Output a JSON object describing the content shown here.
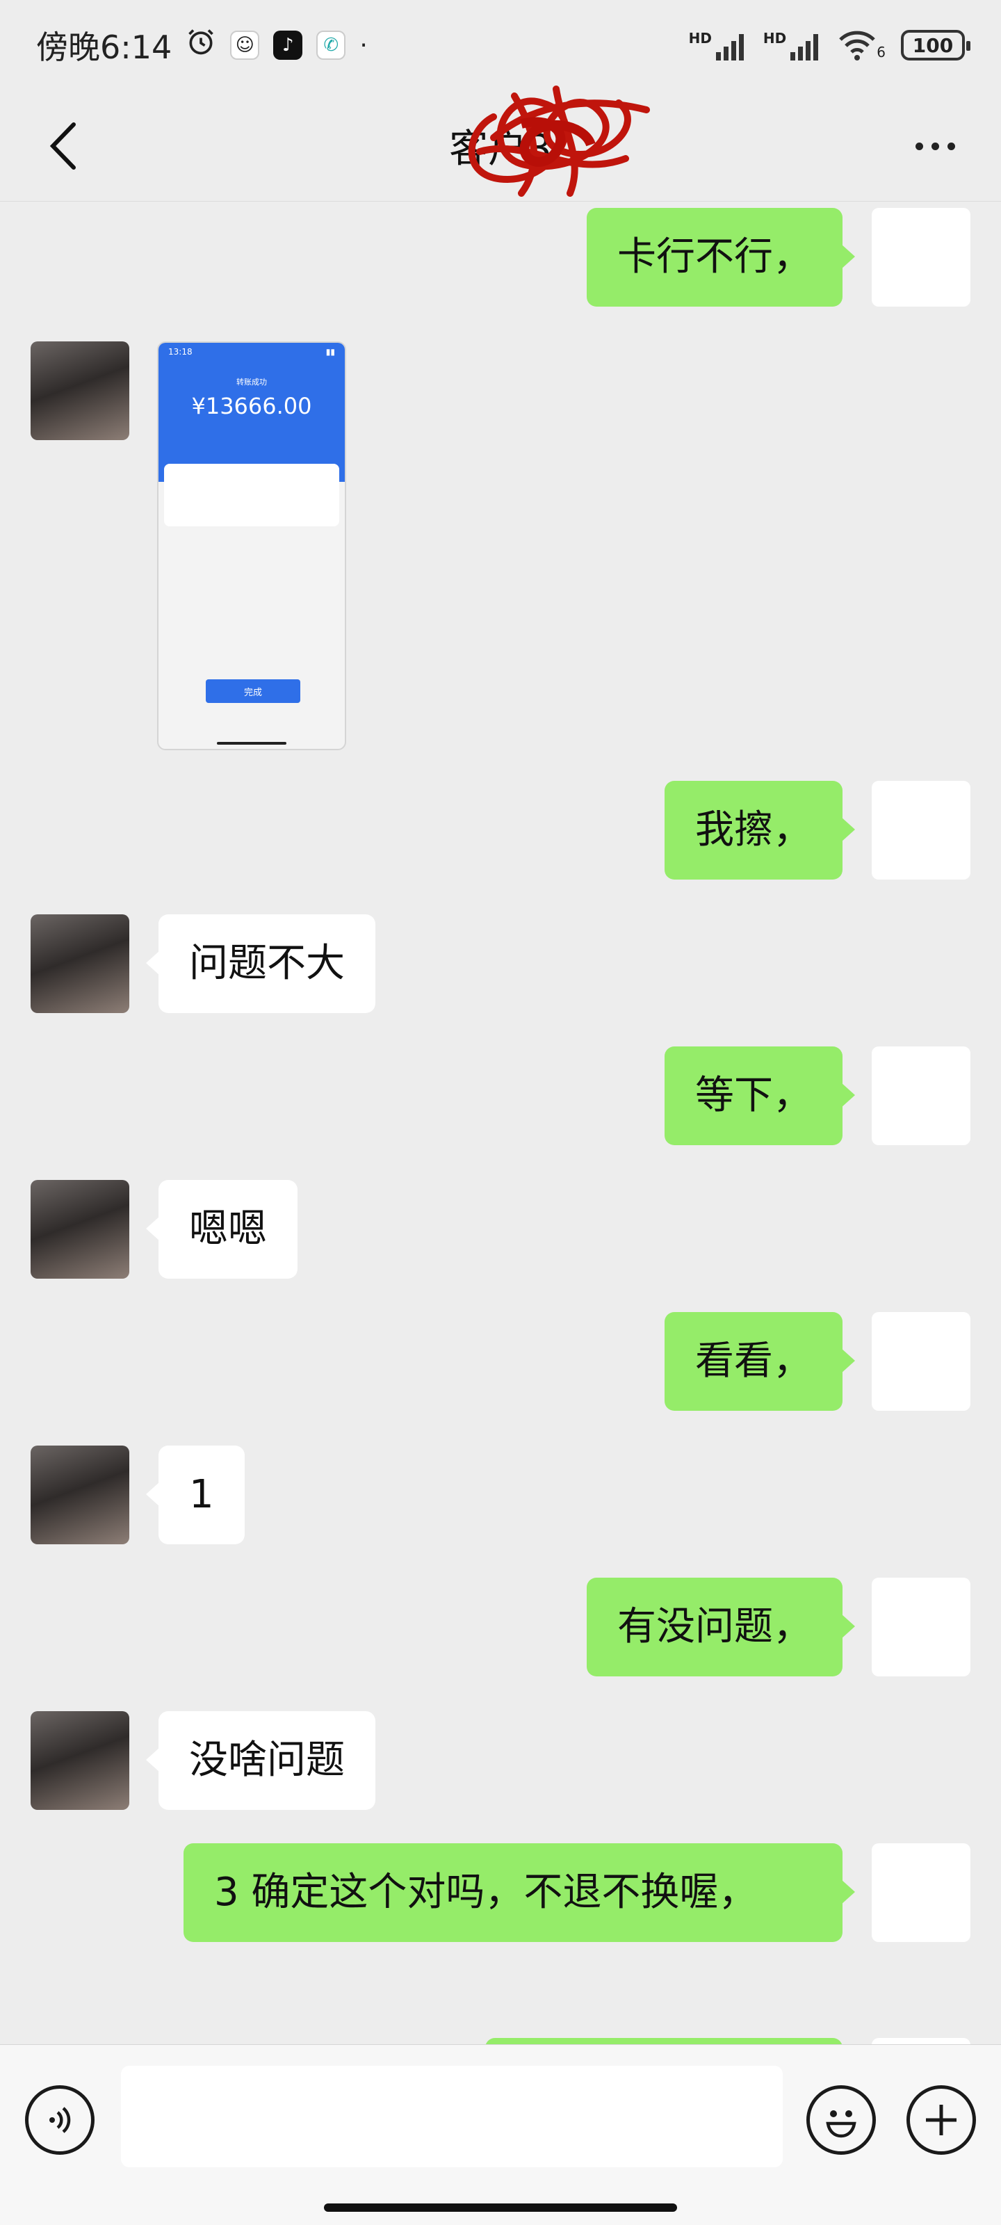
{
  "status_bar": {
    "time": "傍晚6:14",
    "network_1": "HD",
    "network_2": "HD",
    "wifi_sub": "6",
    "battery": "100"
  },
  "header": {
    "title": "客户3"
  },
  "messages": [
    {
      "side": "out",
      "type": "text",
      "text": "卡行不行，"
    },
    {
      "side": "in",
      "type": "image",
      "image": {
        "status_time": "13:18",
        "label": "转账成功",
        "amount": "¥13666.00",
        "done_label": "完成"
      }
    },
    {
      "side": "out",
      "type": "text",
      "text": "我擦，"
    },
    {
      "side": "in",
      "type": "text",
      "text": "问题不大"
    },
    {
      "side": "out",
      "type": "text",
      "text": "等下，"
    },
    {
      "side": "in",
      "type": "text",
      "text": "嗯嗯"
    },
    {
      "side": "out",
      "type": "text",
      "text": "看看，"
    },
    {
      "side": "in",
      "type": "text",
      "text": "1"
    },
    {
      "side": "out",
      "type": "text",
      "text": "有没问题，"
    },
    {
      "side": "in",
      "type": "text",
      "text": "没啥问题"
    },
    {
      "side": "out",
      "type": "text",
      "text": "3  确定这个对吗，不退不换喔，"
    }
  ],
  "input_bar": {
    "placeholder": ""
  },
  "colors": {
    "background": "#ededed",
    "outgoing_bubble": "#95ec69",
    "incoming_bubble": "#ffffff"
  }
}
